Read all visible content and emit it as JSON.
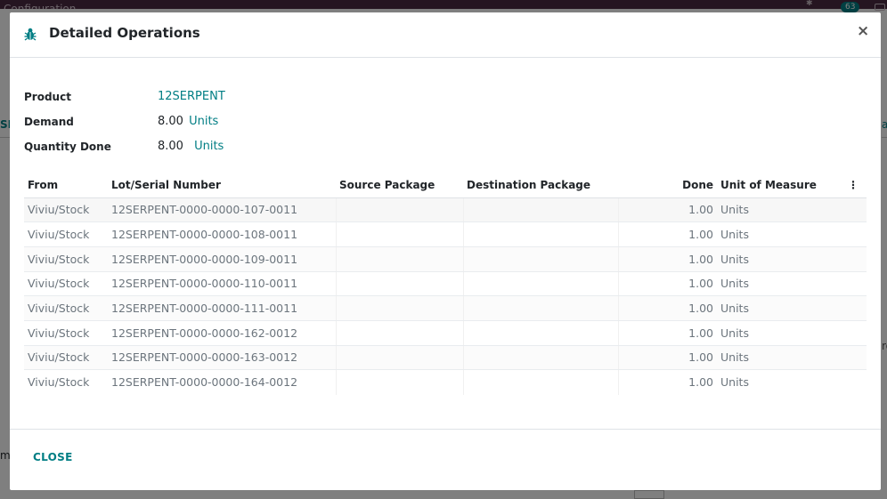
{
  "background": {
    "title": "Configuration",
    "badge_count": "63",
    "left_fragment_1": "SE",
    "left_fragment_2": "ma",
    "right_fragment_1": "al",
    "right_fragment_2": "ro"
  },
  "modal": {
    "title": "Detailed Operations",
    "close_symbol": "×",
    "icon": "bug-icon"
  },
  "fields": {
    "product_label": "Product",
    "product_value": "12SERPENT",
    "demand_label": "Demand",
    "demand_value": "8.00",
    "demand_uom": "Units",
    "qty_done_label": "Quantity Done",
    "qty_done_value": "8.00",
    "qty_done_uom": "Units"
  },
  "table": {
    "columns": [
      "From",
      "Lot/Serial Number",
      "Source Package",
      "Destination Package",
      "Done",
      "Unit of Measure"
    ],
    "options_symbol": "⋮",
    "rows": [
      {
        "from": "Viviu/Stock",
        "lot": "12SERPENT-0000-0000-107-0011",
        "src_pkg": "",
        "dst_pkg": "",
        "done": "1.00",
        "uom": "Units"
      },
      {
        "from": "Viviu/Stock",
        "lot": "12SERPENT-0000-0000-108-0011",
        "src_pkg": "",
        "dst_pkg": "",
        "done": "1.00",
        "uom": "Units"
      },
      {
        "from": "Viviu/Stock",
        "lot": "12SERPENT-0000-0000-109-0011",
        "src_pkg": "",
        "dst_pkg": "",
        "done": "1.00",
        "uom": "Units"
      },
      {
        "from": "Viviu/Stock",
        "lot": "12SERPENT-0000-0000-110-0011",
        "src_pkg": "",
        "dst_pkg": "",
        "done": "1.00",
        "uom": "Units"
      },
      {
        "from": "Viviu/Stock",
        "lot": "12SERPENT-0000-0000-111-0011",
        "src_pkg": "",
        "dst_pkg": "",
        "done": "1.00",
        "uom": "Units"
      },
      {
        "from": "Viviu/Stock",
        "lot": "12SERPENT-0000-0000-162-0012",
        "src_pkg": "",
        "dst_pkg": "",
        "done": "1.00",
        "uom": "Units"
      },
      {
        "from": "Viviu/Stock",
        "lot": "12SERPENT-0000-0000-163-0012",
        "src_pkg": "",
        "dst_pkg": "",
        "done": "1.00",
        "uom": "Units"
      },
      {
        "from": "Viviu/Stock",
        "lot": "12SERPENT-0000-0000-164-0012",
        "src_pkg": "",
        "dst_pkg": "",
        "done": "1.00",
        "uom": "Units"
      }
    ]
  },
  "footer": {
    "close_label": "CLOSE"
  },
  "colors": {
    "accent": "#017e84",
    "topbar": "#4b2a42"
  }
}
